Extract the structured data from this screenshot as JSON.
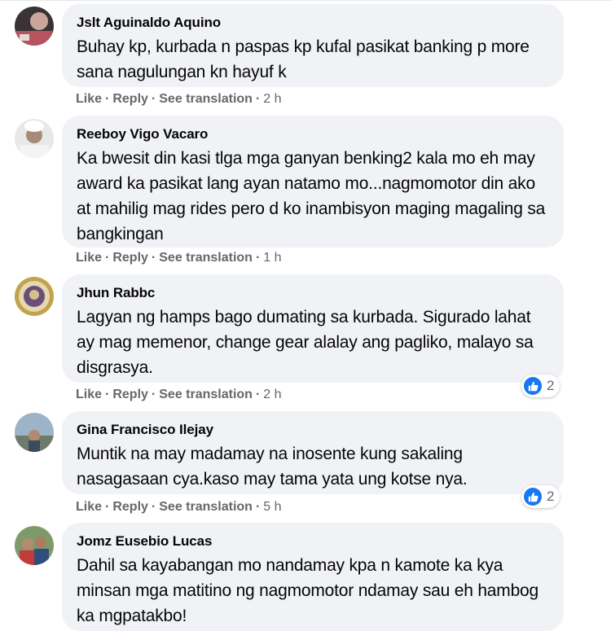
{
  "comments": [
    {
      "author": "Jslt Aguinaldo Aquino",
      "text": "Buhay kp, kurbada n paspas kp kufal pasikat banking p more sana nagulungan kn hayuf k",
      "actions": {
        "like": "Like",
        "reply": "Reply",
        "translate": "See translation",
        "time": "2 h"
      }
    },
    {
      "author": "Reeboy Vigo Vacaro",
      "text": "Ka bwesit din kasi tlga mga ganyan benking2 kala mo eh may award ka pasikat lang ayan natamo mo...nagmomotor din ako at mahilig mag rides pero d ko inambisyon maging magaling sa bangkingan",
      "actions": {
        "like": "Like",
        "reply": "Reply",
        "translate": "See translation",
        "time": "1 h"
      }
    },
    {
      "author": "Jhun Rabbc",
      "text": "Lagyan ng hamps bago dumating sa kurbada. Sigurado lahat ay mag memenor, change gear alalay ang pagliko, malayo sa disgrasya.",
      "actions": {
        "like": "Like",
        "reply": "Reply",
        "translate": "See translation",
        "time": "2 h"
      },
      "reaction_count": "2"
    },
    {
      "author": "Gina Francisco Ilejay",
      "text": "Muntik na may madamay na inosente kung sakaling nasagasaan cya.kaso may tama yata ung kotse nya.",
      "actions": {
        "like": "Like",
        "reply": "Reply",
        "translate": "See translation",
        "time": "5 h"
      },
      "reaction_count": "2"
    },
    {
      "author": "Jomz Eusebio Lucas",
      "text": "Dahil sa kayabangan mo nandamay kpa n kamote ka kya minsan mga matitino ng nagmomotor ndamay sau eh hambog ka mgpatakbo!"
    }
  ],
  "colors": {
    "bubble": "#f0f2f5",
    "like_blue": "#1877f2",
    "meta_gray": "#65676b"
  },
  "icons": {
    "reaction": "like-thumb-icon"
  }
}
